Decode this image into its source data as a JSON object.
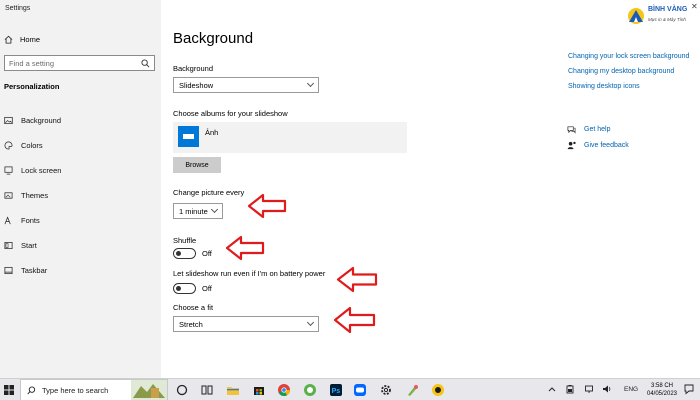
{
  "window": {
    "title": "Settings"
  },
  "sidebar": {
    "home_label": "Home",
    "search_placeholder": "Find a setting",
    "section_label": "Personalization",
    "items": [
      {
        "label": "Background",
        "icon": "picture-icon"
      },
      {
        "label": "Colors",
        "icon": "palette-icon"
      },
      {
        "label": "Lock screen",
        "icon": "lock-screen-icon"
      },
      {
        "label": "Themes",
        "icon": "themes-icon"
      },
      {
        "label": "Fonts",
        "icon": "fonts-icon"
      },
      {
        "label": "Start",
        "icon": "start-icon"
      },
      {
        "label": "Taskbar",
        "icon": "taskbar-icon"
      }
    ]
  },
  "main": {
    "title": "Background",
    "background_label": "Background",
    "background_value": "Slideshow",
    "albums_label": "Choose albums for your slideshow",
    "album_name": "Ảnh",
    "browse_label": "Browse",
    "interval_label": "Change picture every",
    "interval_value": "1 minute",
    "shuffle_label": "Shuffle",
    "shuffle_state": "Off",
    "battery_label": "Let slideshow run even if I'm on battery power",
    "battery_state": "Off",
    "fit_label": "Choose a fit",
    "fit_value": "Stretch"
  },
  "related": {
    "links": [
      "Changing your lock screen background",
      "Changing my desktop background",
      "Showing desktop icons"
    ],
    "get_help": "Get help",
    "give_feedback": "Give feedback"
  },
  "logo": {
    "name": "BÌNH VÀNG",
    "tagline": "Mực in & Máy Tính"
  },
  "taskbar": {
    "search_placeholder": "Type here to search",
    "language": "ENG",
    "time": "3:58 CH",
    "date": "04/05/2023"
  },
  "colors": {
    "accent": "#0078d7",
    "link": "#0063b1",
    "annotation_arrow": "#e01b1b"
  }
}
